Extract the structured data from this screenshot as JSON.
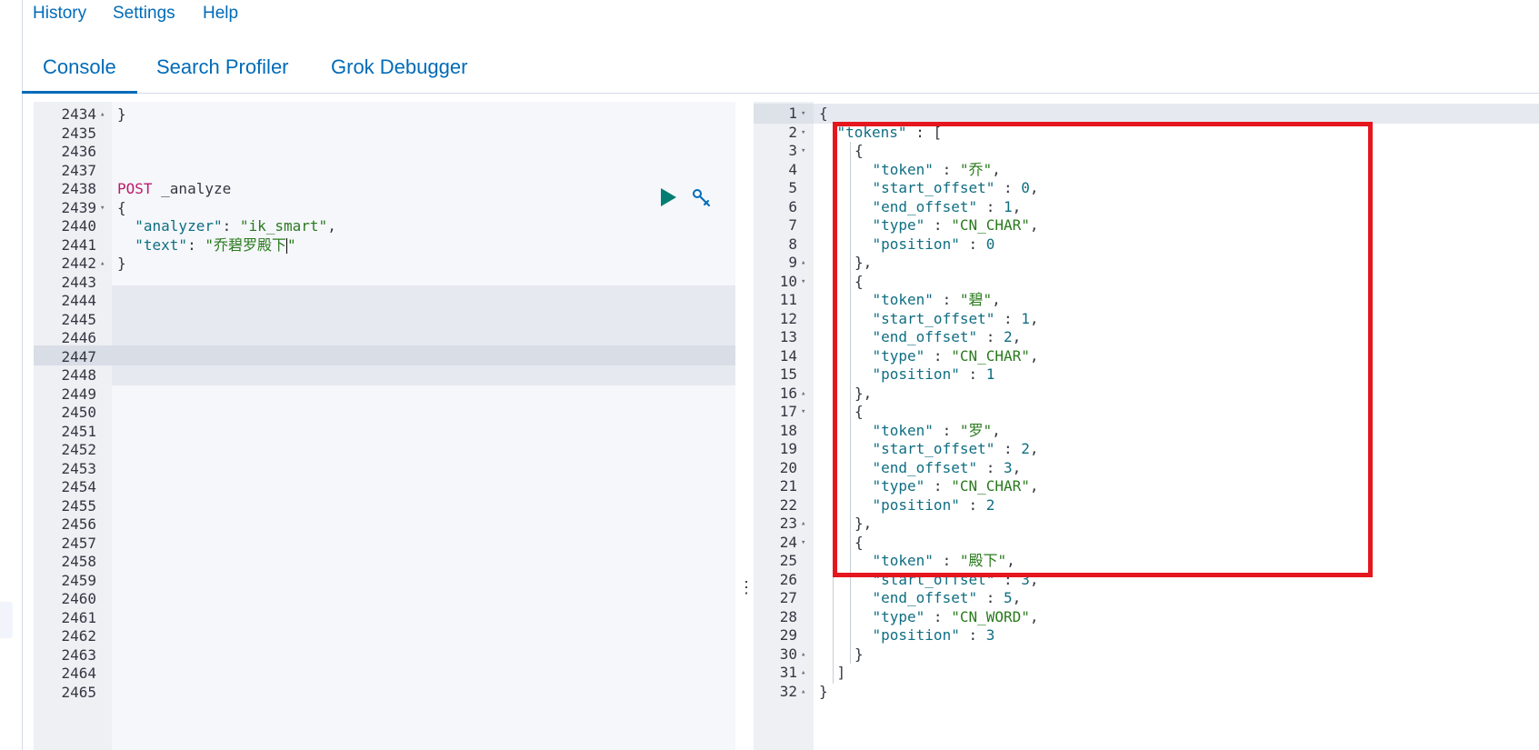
{
  "menu": {
    "history": "History",
    "settings": "Settings",
    "help": "Help"
  },
  "tabs": [
    {
      "label": "Console",
      "active": true
    },
    {
      "label": "Search Profiler",
      "active": false
    },
    {
      "label": "Grok Debugger",
      "active": false
    }
  ],
  "request_editor": {
    "lines": [
      {
        "num": "2434",
        "fold": "▴",
        "code": "}"
      },
      {
        "num": "2435",
        "fold": "",
        "code": ""
      },
      {
        "num": "2436",
        "fold": "",
        "code": ""
      },
      {
        "num": "2437",
        "fold": "",
        "code": ""
      },
      {
        "num": "2438",
        "fold": "",
        "method": "POST",
        "path": " _analyze"
      },
      {
        "num": "2439",
        "fold": "▾",
        "code": "{"
      },
      {
        "num": "2440",
        "fold": "",
        "key": "  \"analyzer\"",
        "sep": ": ",
        "str": "\"ik_smart\"",
        "tail": ","
      },
      {
        "num": "2441",
        "fold": "",
        "key": "  \"text\"",
        "sep": ": ",
        "str": "\"乔碧罗殿下",
        "str2": "\"",
        "tail": ""
      },
      {
        "num": "2442",
        "fold": "▴",
        "code": "}"
      },
      {
        "num": "2443"
      },
      {
        "num": "2444"
      },
      {
        "num": "2445"
      },
      {
        "num": "2446"
      },
      {
        "num": "2447"
      },
      {
        "num": "2448"
      },
      {
        "num": "2449"
      },
      {
        "num": "2450"
      },
      {
        "num": "2451"
      },
      {
        "num": "2452"
      },
      {
        "num": "2453"
      },
      {
        "num": "2454"
      },
      {
        "num": "2455"
      },
      {
        "num": "2456"
      },
      {
        "num": "2457"
      },
      {
        "num": "2458"
      },
      {
        "num": "2459"
      },
      {
        "num": "2460"
      },
      {
        "num": "2461"
      },
      {
        "num": "2462"
      },
      {
        "num": "2463"
      },
      {
        "num": "2464"
      },
      {
        "num": "2465"
      }
    ],
    "play_icon": "play-icon",
    "wrench_icon": "wrench-icon"
  },
  "response_output": {
    "lines": [
      {
        "num": "1",
        "fold": "▾",
        "indent": 0,
        "parts": [
          [
            "p",
            "{"
          ]
        ]
      },
      {
        "num": "2",
        "fold": "▾",
        "indent": 1,
        "parts": [
          [
            "k",
            "\"tokens\""
          ],
          [
            "p",
            " : ["
          ]
        ]
      },
      {
        "num": "3",
        "fold": "▾",
        "indent": 2,
        "parts": [
          [
            "p",
            "{"
          ]
        ]
      },
      {
        "num": "4",
        "fold": "",
        "indent": 3,
        "parts": [
          [
            "k",
            "\"token\""
          ],
          [
            "p",
            " : "
          ],
          [
            "s",
            "\"乔\""
          ],
          [
            "p",
            ","
          ]
        ]
      },
      {
        "num": "5",
        "fold": "",
        "indent": 3,
        "parts": [
          [
            "k",
            "\"start_offset\""
          ],
          [
            "p",
            " : "
          ],
          [
            "n",
            "0"
          ],
          [
            "p",
            ","
          ]
        ]
      },
      {
        "num": "6",
        "fold": "",
        "indent": 3,
        "parts": [
          [
            "k",
            "\"end_offset\""
          ],
          [
            "p",
            " : "
          ],
          [
            "n",
            "1"
          ],
          [
            "p",
            ","
          ]
        ]
      },
      {
        "num": "7",
        "fold": "",
        "indent": 3,
        "parts": [
          [
            "k",
            "\"type\""
          ],
          [
            "p",
            " : "
          ],
          [
            "s",
            "\"CN_CHAR\""
          ],
          [
            "p",
            ","
          ]
        ]
      },
      {
        "num": "8",
        "fold": "",
        "indent": 3,
        "parts": [
          [
            "k",
            "\"position\""
          ],
          [
            "p",
            " : "
          ],
          [
            "n",
            "0"
          ]
        ]
      },
      {
        "num": "9",
        "fold": "▴",
        "indent": 2,
        "parts": [
          [
            "p",
            "},"
          ]
        ]
      },
      {
        "num": "10",
        "fold": "▾",
        "indent": 2,
        "parts": [
          [
            "p",
            "{"
          ]
        ]
      },
      {
        "num": "11",
        "fold": "",
        "indent": 3,
        "parts": [
          [
            "k",
            "\"token\""
          ],
          [
            "p",
            " : "
          ],
          [
            "s",
            "\"碧\""
          ],
          [
            "p",
            ","
          ]
        ]
      },
      {
        "num": "12",
        "fold": "",
        "indent": 3,
        "parts": [
          [
            "k",
            "\"start_offset\""
          ],
          [
            "p",
            " : "
          ],
          [
            "n",
            "1"
          ],
          [
            "p",
            ","
          ]
        ]
      },
      {
        "num": "13",
        "fold": "",
        "indent": 3,
        "parts": [
          [
            "k",
            "\"end_offset\""
          ],
          [
            "p",
            " : "
          ],
          [
            "n",
            "2"
          ],
          [
            "p",
            ","
          ]
        ]
      },
      {
        "num": "14",
        "fold": "",
        "indent": 3,
        "parts": [
          [
            "k",
            "\"type\""
          ],
          [
            "p",
            " : "
          ],
          [
            "s",
            "\"CN_CHAR\""
          ],
          [
            "p",
            ","
          ]
        ]
      },
      {
        "num": "15",
        "fold": "",
        "indent": 3,
        "parts": [
          [
            "k",
            "\"position\""
          ],
          [
            "p",
            " : "
          ],
          [
            "n",
            "1"
          ]
        ]
      },
      {
        "num": "16",
        "fold": "▴",
        "indent": 2,
        "parts": [
          [
            "p",
            "},"
          ]
        ]
      },
      {
        "num": "17",
        "fold": "▾",
        "indent": 2,
        "parts": [
          [
            "p",
            "{"
          ]
        ]
      },
      {
        "num": "18",
        "fold": "",
        "indent": 3,
        "parts": [
          [
            "k",
            "\"token\""
          ],
          [
            "p",
            " : "
          ],
          [
            "s",
            "\"罗\""
          ],
          [
            "p",
            ","
          ]
        ]
      },
      {
        "num": "19",
        "fold": "",
        "indent": 3,
        "parts": [
          [
            "k",
            "\"start_offset\""
          ],
          [
            "p",
            " : "
          ],
          [
            "n",
            "2"
          ],
          [
            "p",
            ","
          ]
        ]
      },
      {
        "num": "20",
        "fold": "",
        "indent": 3,
        "parts": [
          [
            "k",
            "\"end_offset\""
          ],
          [
            "p",
            " : "
          ],
          [
            "n",
            "3"
          ],
          [
            "p",
            ","
          ]
        ]
      },
      {
        "num": "21",
        "fold": "",
        "indent": 3,
        "parts": [
          [
            "k",
            "\"type\""
          ],
          [
            "p",
            " : "
          ],
          [
            "s",
            "\"CN_CHAR\""
          ],
          [
            "p",
            ","
          ]
        ]
      },
      {
        "num": "22",
        "fold": "",
        "indent": 3,
        "parts": [
          [
            "k",
            "\"position\""
          ],
          [
            "p",
            " : "
          ],
          [
            "n",
            "2"
          ]
        ]
      },
      {
        "num": "23",
        "fold": "▴",
        "indent": 2,
        "parts": [
          [
            "p",
            "},"
          ]
        ]
      },
      {
        "num": "24",
        "fold": "▾",
        "indent": 2,
        "parts": [
          [
            "p",
            "{"
          ]
        ]
      },
      {
        "num": "25",
        "fold": "",
        "indent": 3,
        "parts": [
          [
            "k",
            "\"token\""
          ],
          [
            "p",
            " : "
          ],
          [
            "s",
            "\"殿下\""
          ],
          [
            "p",
            ","
          ]
        ]
      },
      {
        "num": "26",
        "fold": "",
        "indent": 3,
        "parts": [
          [
            "k",
            "\"start_offset\""
          ],
          [
            "p",
            " : "
          ],
          [
            "n",
            "3"
          ],
          [
            "p",
            ","
          ]
        ]
      },
      {
        "num": "27",
        "fold": "",
        "indent": 3,
        "parts": [
          [
            "k",
            "\"end_offset\""
          ],
          [
            "p",
            " : "
          ],
          [
            "n",
            "5"
          ],
          [
            "p",
            ","
          ]
        ]
      },
      {
        "num": "28",
        "fold": "",
        "indent": 3,
        "parts": [
          [
            "k",
            "\"type\""
          ],
          [
            "p",
            " : "
          ],
          [
            "s",
            "\"CN_WORD\""
          ],
          [
            "p",
            ","
          ]
        ]
      },
      {
        "num": "29",
        "fold": "",
        "indent": 3,
        "parts": [
          [
            "k",
            "\"position\""
          ],
          [
            "p",
            " : "
          ],
          [
            "n",
            "3"
          ]
        ]
      },
      {
        "num": "30",
        "fold": "▴",
        "indent": 2,
        "parts": [
          [
            "p",
            "}"
          ]
        ]
      },
      {
        "num": "31",
        "fold": "▴",
        "indent": 1,
        "parts": [
          [
            "p",
            "]"
          ]
        ]
      },
      {
        "num": "32",
        "fold": "▴",
        "indent": 0,
        "parts": [
          [
            "p",
            "}"
          ]
        ]
      }
    ]
  },
  "colors": {
    "link": "#006bb8",
    "method": "#bd1b6c",
    "key": "#0f6e82",
    "string": "#2a7a1e",
    "highlight_box": "#e5161e"
  }
}
